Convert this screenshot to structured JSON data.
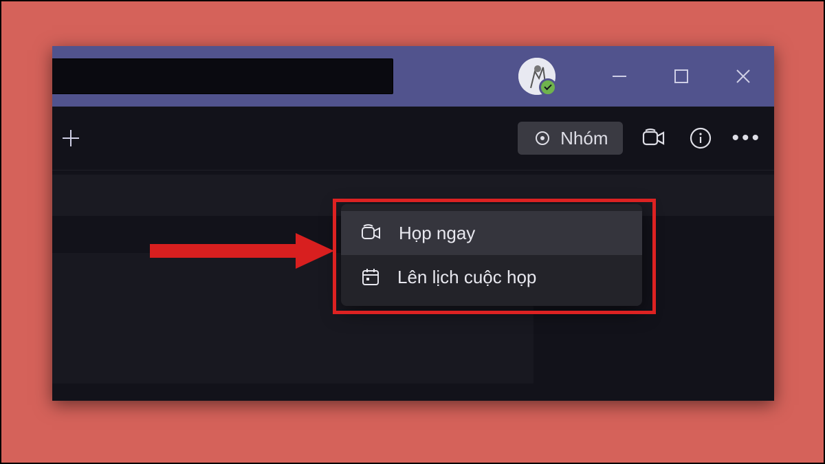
{
  "titlebar": {
    "presence_status": "available"
  },
  "toolbar": {
    "group_pill_label": "Nhóm"
  },
  "menu": {
    "meet_now_label": "Họp ngay",
    "schedule_label": "Lên lịch cuộc họp"
  }
}
